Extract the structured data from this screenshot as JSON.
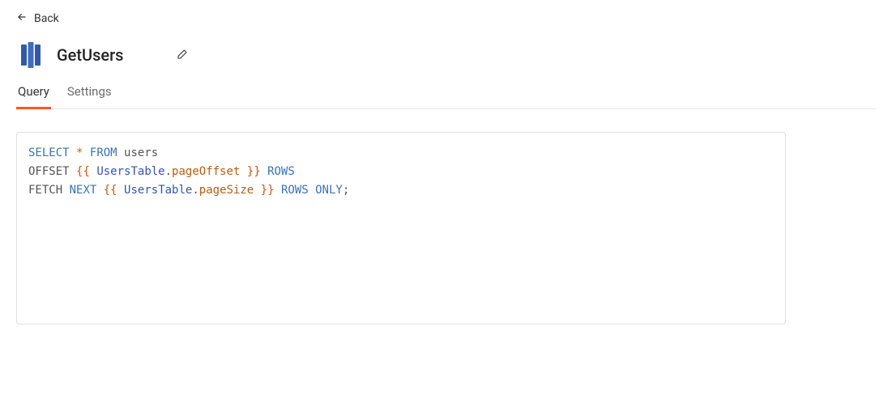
{
  "back": {
    "label": "Back"
  },
  "header": {
    "title": "GetUsers"
  },
  "tabs": {
    "query": "Query",
    "settings": "Settings",
    "active": "query"
  },
  "editor": {
    "lines": [
      [
        {
          "t": "SELECT",
          "c": "kw"
        },
        {
          "t": " ",
          "c": "plain"
        },
        {
          "t": "*",
          "c": "glob"
        },
        {
          "t": " ",
          "c": "plain"
        },
        {
          "t": "FROM",
          "c": "kw"
        },
        {
          "t": " users",
          "c": "plain"
        }
      ],
      [
        {
          "t": "OFFSET ",
          "c": "plain"
        },
        {
          "t": "{{",
          "c": "mdbr"
        },
        {
          "t": " ",
          "c": "plain"
        },
        {
          "t": "UsersTable",
          "c": "ident"
        },
        {
          "t": ".",
          "c": "dot"
        },
        {
          "t": "pageOffset",
          "c": "prop"
        },
        {
          "t": " ",
          "c": "plain"
        },
        {
          "t": "}}",
          "c": "mdbr"
        },
        {
          "t": " ",
          "c": "plain"
        },
        {
          "t": "ROWS",
          "c": "kw"
        }
      ],
      [
        {
          "t": "FETCH",
          "c": "plain"
        },
        {
          "t": " ",
          "c": "plain"
        },
        {
          "t": "NEXT",
          "c": "kw"
        },
        {
          "t": " ",
          "c": "plain"
        },
        {
          "t": "{{",
          "c": "mdbr"
        },
        {
          "t": " ",
          "c": "plain"
        },
        {
          "t": "UsersTable",
          "c": "ident"
        },
        {
          "t": ".",
          "c": "dot"
        },
        {
          "t": "pageSize",
          "c": "prop"
        },
        {
          "t": " ",
          "c": "plain"
        },
        {
          "t": "}}",
          "c": "mdbr"
        },
        {
          "t": " ",
          "c": "plain"
        },
        {
          "t": "ROWS",
          "c": "kw"
        },
        {
          "t": " ",
          "c": "plain"
        },
        {
          "t": "ONLY",
          "c": "kw"
        },
        {
          "t": ";",
          "c": "plain"
        }
      ]
    ]
  }
}
